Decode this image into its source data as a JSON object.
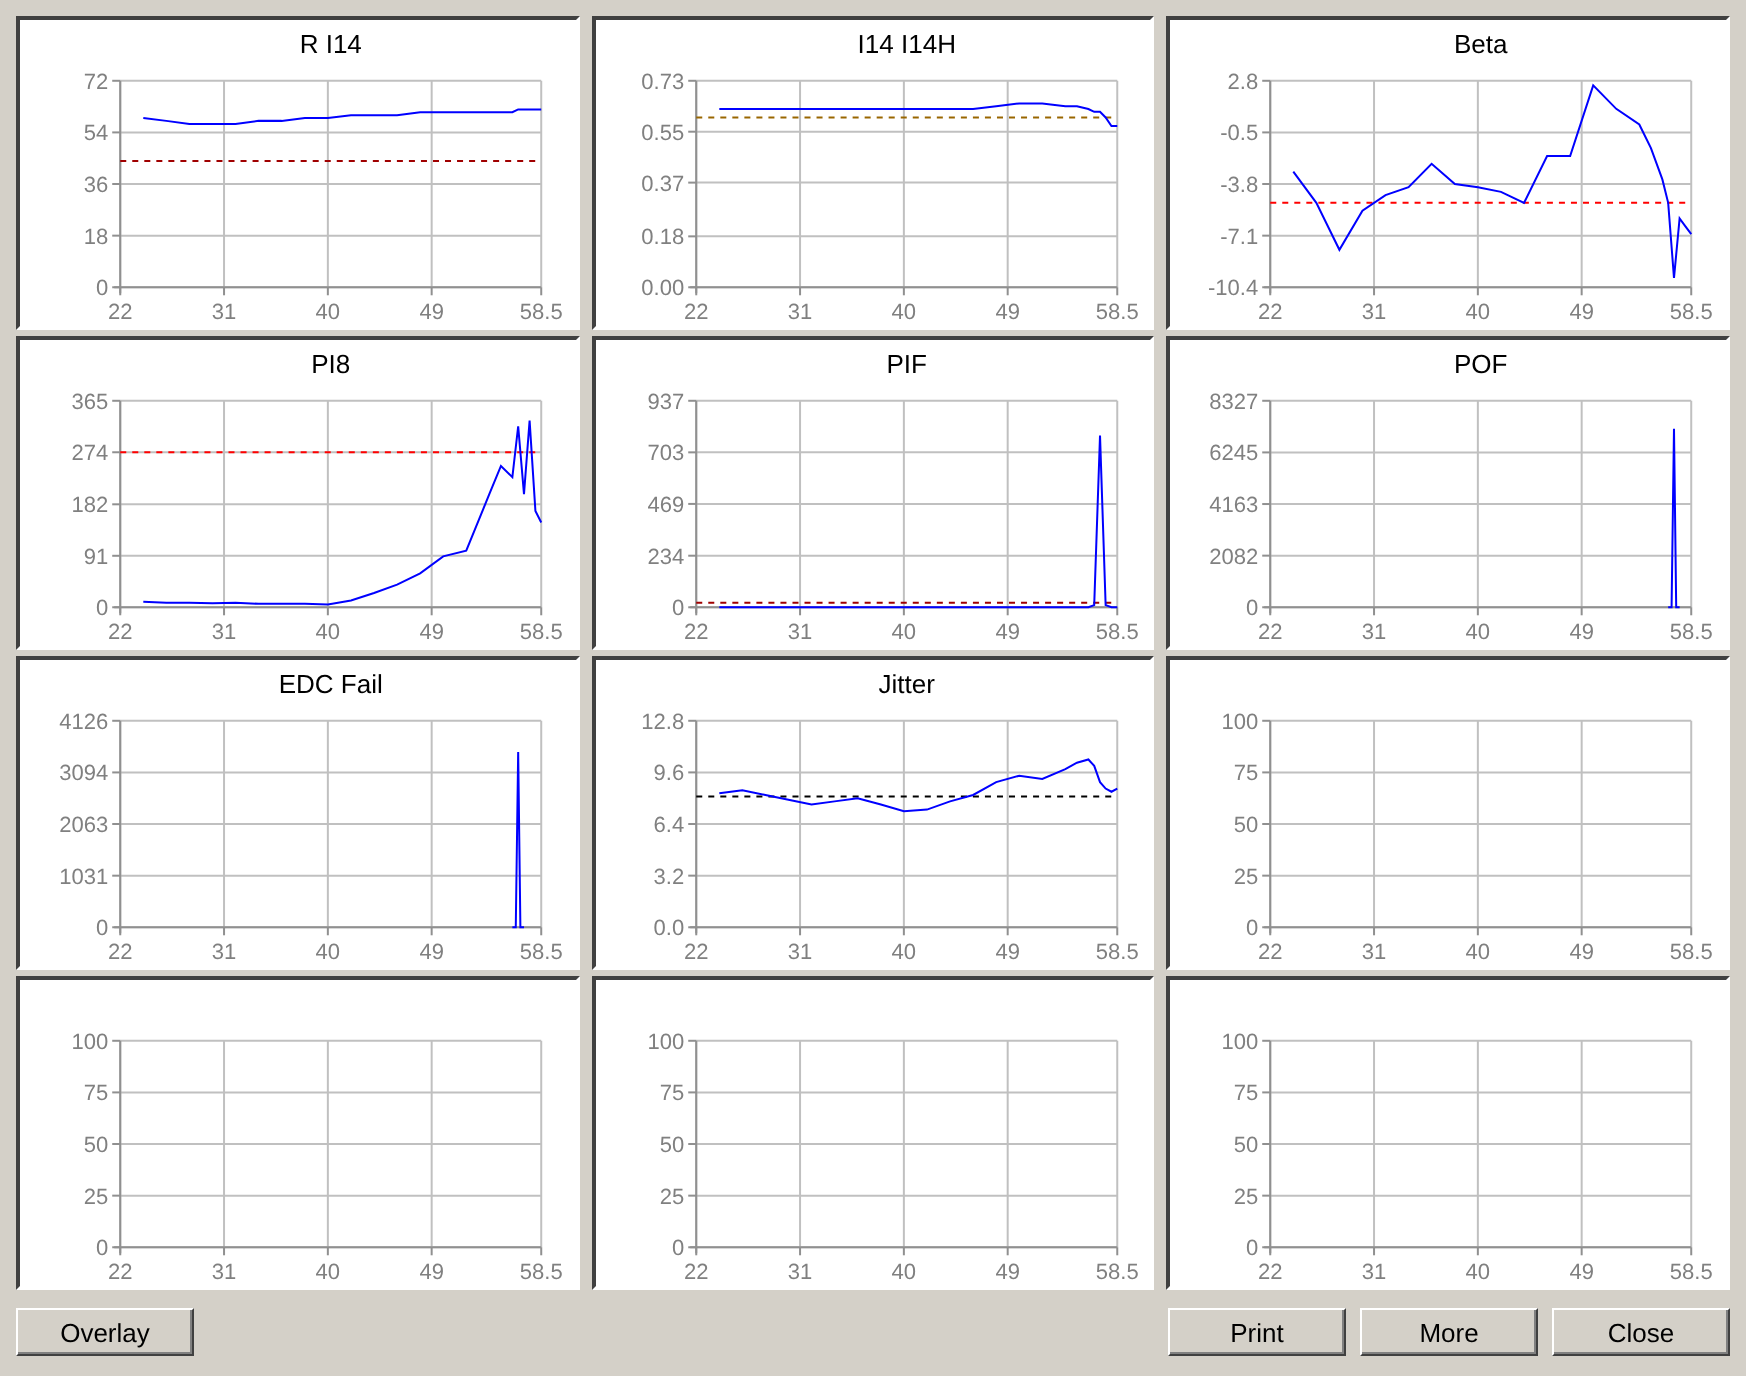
{
  "charts": [
    {
      "chart_data": {
        "type": "line",
        "title": "R I14",
        "xlim": [
          22,
          58.5
        ],
        "ylim": [
          0,
          72
        ],
        "xticks": [
          22,
          31,
          40,
          49,
          58.5
        ],
        "yticks": [
          0,
          18,
          36,
          54,
          72
        ],
        "x": [
          24,
          26,
          28,
          30,
          32,
          34,
          36,
          38,
          40,
          42,
          44,
          46,
          48,
          50,
          52,
          54,
          55,
          56,
          56.5,
          57,
          57.5,
          58,
          58.5
        ],
        "series": [
          {
            "color": "#0000ff",
            "values": [
              59,
              58,
              57,
              57,
              57,
              58,
              58,
              59,
              59,
              60,
              60,
              60,
              61,
              61,
              61,
              61,
              61,
              61,
              62,
              62,
              62,
              62,
              62
            ]
          }
        ],
        "ref_lines": [
          {
            "axis": "y",
            "value": 44,
            "color": "#a00000"
          }
        ],
        "grid": true
      }
    },
    {
      "chart_data": {
        "type": "line",
        "title": "I14 I14H",
        "xlim": [
          22,
          58.5
        ],
        "ylim": [
          0,
          0.73
        ],
        "xticks": [
          22,
          31,
          40,
          49,
          58.5
        ],
        "yticks": [
          {
            "value": 0,
            "label": "0.00"
          },
          {
            "value": 0.18,
            "label": "0.18"
          },
          {
            "value": 0.37,
            "label": "0.37"
          },
          {
            "value": 0.55,
            "label": "0.55"
          },
          {
            "value": 0.73,
            "label": "0.73"
          }
        ],
        "x": [
          24,
          26,
          28,
          30,
          32,
          34,
          36,
          38,
          40,
          42,
          44,
          46,
          48,
          50,
          52,
          54,
          55,
          56,
          56.5,
          57,
          57.5,
          58,
          58.5
        ],
        "series": [
          {
            "color": "#0000ff",
            "values": [
              0.63,
              0.63,
              0.63,
              0.63,
              0.63,
              0.63,
              0.63,
              0.63,
              0.63,
              0.63,
              0.63,
              0.63,
              0.64,
              0.65,
              0.65,
              0.64,
              0.64,
              0.63,
              0.62,
              0.62,
              0.6,
              0.57,
              0.57
            ]
          }
        ],
        "ref_lines": [
          {
            "axis": "y",
            "value": 0.6,
            "color": "#996600"
          }
        ],
        "grid": true
      }
    },
    {
      "chart_data": {
        "type": "line",
        "title": "Beta",
        "xlim": [
          22,
          58.5
        ],
        "ylim": [
          -10.4,
          2.8
        ],
        "xticks": [
          22,
          31,
          40,
          49,
          58.5
        ],
        "yticks": [
          -10.4,
          -7.1,
          -3.8,
          -0.5,
          2.8
        ],
        "x": [
          24,
          26,
          28,
          30,
          32,
          34,
          36,
          38,
          40,
          42,
          44,
          46,
          48,
          50,
          52,
          54,
          55,
          56,
          56.5,
          57,
          57.5,
          58,
          58.5
        ],
        "series": [
          {
            "color": "#0000ff",
            "values": [
              -3,
              -5,
              -8,
              -5.5,
              -4.5,
              -4,
              -2.5,
              -3.8,
              -4,
              -4.3,
              -5,
              -2,
              -2,
              2.5,
              1,
              0,
              -1.5,
              -3.5,
              -5,
              -9.8,
              -6,
              -6.5,
              -7
            ]
          }
        ],
        "ref_lines": [
          {
            "axis": "y",
            "value": -5,
            "color": "#ff0000"
          }
        ],
        "grid": true
      }
    },
    {
      "chart_data": {
        "type": "line",
        "title": "PI8",
        "xlim": [
          22,
          58.5
        ],
        "ylim": [
          0,
          365
        ],
        "xticks": [
          22,
          31,
          40,
          49,
          58.5
        ],
        "yticks": [
          0,
          91,
          182,
          274,
          365
        ],
        "x": [
          24,
          26,
          28,
          30,
          32,
          34,
          36,
          38,
          40,
          42,
          44,
          46,
          48,
          50,
          52,
          54,
          55,
          56,
          56.5,
          57,
          57.5,
          58,
          58.5
        ],
        "series": [
          {
            "color": "#0000ff",
            "values": [
              10,
              8,
              8,
              7,
              8,
              6,
              6,
              6,
              5,
              12,
              25,
              40,
              60,
              90,
              100,
              200,
              250,
              230,
              320,
              200,
              330,
              170,
              150
            ]
          }
        ],
        "ref_lines": [
          {
            "axis": "y",
            "value": 274,
            "color": "#ff0000"
          }
        ],
        "grid": true
      }
    },
    {
      "chart_data": {
        "type": "line",
        "title": "PIF",
        "xlim": [
          22,
          58.5
        ],
        "ylim": [
          0,
          937
        ],
        "xticks": [
          22,
          31,
          40,
          49,
          58.5
        ],
        "yticks": [
          0,
          234,
          469,
          703,
          937
        ],
        "x": [
          24,
          26,
          28,
          30,
          32,
          34,
          36,
          38,
          40,
          42,
          44,
          46,
          48,
          50,
          52,
          54,
          55,
          56,
          56.5,
          57,
          57.5,
          58,
          58.5
        ],
        "series": [
          {
            "color": "#0000ff",
            "values": [
              0,
              0,
              0,
              0,
              0,
              0,
              0,
              0,
              0,
              0,
              0,
              0,
              0,
              0,
              0,
              0,
              0,
              0,
              10,
              780,
              10,
              0,
              0
            ]
          }
        ],
        "ref_lines": [
          {
            "axis": "y",
            "value": 20,
            "color": "#a00000"
          }
        ],
        "grid": true
      }
    },
    {
      "chart_data": {
        "type": "line",
        "title": "POF",
        "xlim": [
          22,
          58.5
        ],
        "ylim": [
          0,
          8327
        ],
        "xticks": [
          22,
          31,
          40,
          49,
          58.5
        ],
        "yticks": [
          0,
          2082,
          4163,
          6245,
          8327
        ],
        "x": [
          56.5,
          56.8,
          57,
          57.2,
          57.5
        ],
        "series": [
          {
            "color": "#0000ff",
            "values": [
              0,
              0,
              7200,
              0,
              0
            ]
          }
        ],
        "grid": true
      }
    },
    {
      "chart_data": {
        "type": "line",
        "title": "EDC Fail",
        "xlim": [
          22,
          58.5
        ],
        "ylim": [
          0,
          4126
        ],
        "xticks": [
          22,
          31,
          40,
          49,
          58.5
        ],
        "yticks": [
          0,
          1031,
          2063,
          3094,
          4126
        ],
        "x": [
          56,
          56.3,
          56.5,
          56.7,
          57
        ],
        "series": [
          {
            "color": "#0000ff",
            "values": [
              0,
              0,
              3500,
              0,
              0
            ]
          }
        ],
        "grid": true
      }
    },
    {
      "chart_data": {
        "type": "line",
        "title": "Jitter",
        "xlim": [
          22,
          58.5
        ],
        "ylim": [
          0,
          12.8
        ],
        "xticks": [
          22,
          31,
          40,
          49,
          58.5
        ],
        "yticks": [
          {
            "value": 0,
            "label": "0.0"
          },
          {
            "value": 3.2,
            "label": "3.2"
          },
          {
            "value": 6.4,
            "label": "6.4"
          },
          {
            "value": 9.6,
            "label": "9.6"
          },
          {
            "value": 12.8,
            "label": "12.8"
          }
        ],
        "x": [
          24,
          26,
          28,
          30,
          32,
          34,
          36,
          38,
          40,
          42,
          44,
          46,
          48,
          50,
          52,
          54,
          55,
          56,
          56.5,
          57,
          57.5,
          58,
          58.5
        ],
        "series": [
          {
            "color": "#0000ff",
            "values": [
              8.3,
              8.5,
              8.2,
              7.9,
              7.6,
              7.8,
              8.0,
              7.6,
              7.2,
              7.3,
              7.8,
              8.2,
              9.0,
              9.4,
              9.2,
              9.8,
              10.2,
              10.4,
              10.0,
              9.0,
              8.6,
              8.4,
              8.6
            ]
          }
        ],
        "ref_lines": [
          {
            "axis": "y",
            "value": 8.1,
            "color": "#000000"
          }
        ],
        "grid": true
      }
    },
    {
      "chart_data": {
        "type": "line",
        "xlim": [
          22,
          58.5
        ],
        "ylim": [
          0,
          100
        ],
        "xticks": [
          22,
          31,
          40,
          49,
          58.5
        ],
        "yticks": [
          0,
          25,
          50,
          75,
          100
        ],
        "grid": true
      }
    },
    {
      "chart_data": {
        "type": "line",
        "xlim": [
          22,
          58.5
        ],
        "ylim": [
          0,
          100
        ],
        "xticks": [
          22,
          31,
          40,
          49,
          58.5
        ],
        "yticks": [
          0,
          25,
          50,
          75,
          100
        ],
        "grid": true
      }
    },
    {
      "chart_data": {
        "type": "line",
        "xlim": [
          22,
          58.5
        ],
        "ylim": [
          0,
          100
        ],
        "xticks": [
          22,
          31,
          40,
          49,
          58.5
        ],
        "yticks": [
          0,
          25,
          50,
          75,
          100
        ],
        "grid": true
      }
    },
    {
      "chart_data": {
        "type": "line",
        "xlim": [
          22,
          58.5
        ],
        "ylim": [
          0,
          100
        ],
        "xticks": [
          22,
          31,
          40,
          49,
          58.5
        ],
        "yticks": [
          0,
          25,
          50,
          75,
          100
        ],
        "grid": true
      }
    }
  ],
  "buttons_left": [
    "Overlay"
  ],
  "buttons_right": [
    "Print",
    "More",
    "Close"
  ]
}
